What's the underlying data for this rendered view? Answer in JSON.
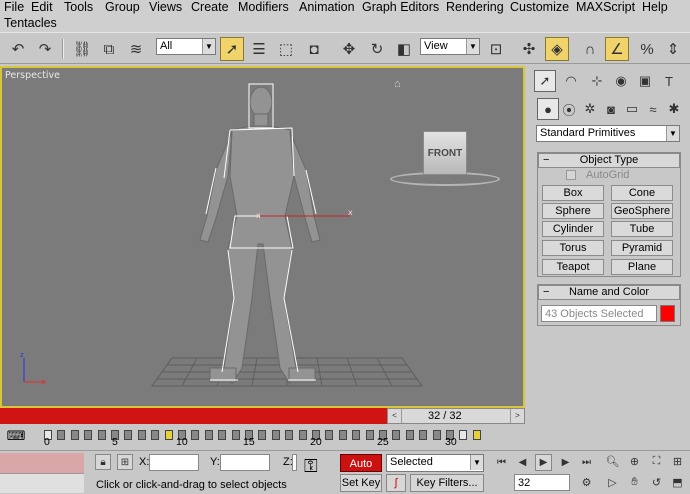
{
  "menu": {
    "items": [
      "File",
      "Edit",
      "Tools",
      "Group",
      "Views",
      "Create",
      "Modifiers",
      "Animation",
      "Graph Editors",
      "Rendering",
      "Customize",
      "MAXScript",
      "Help"
    ],
    "second_row": "Tentacles"
  },
  "toolbar": {
    "selection_filter": "All",
    "reference_coord": "View"
  },
  "viewport": {
    "label": "Perspective",
    "viewcube_face": "FRONT"
  },
  "timeline": {
    "frame_display": "32 / 32",
    "tick_labels": [
      "0",
      "5",
      "10",
      "15",
      "20",
      "25",
      "30"
    ]
  },
  "command_panel": {
    "category": "Standard Primitives",
    "object_type_title": "Object Type",
    "autogrid_label": "AutoGrid",
    "primitives": [
      "Box",
      "Cone",
      "Sphere",
      "GeoSphere",
      "Cylinder",
      "Tube",
      "Torus",
      "Pyramid",
      "Teapot",
      "Plane"
    ],
    "name_color_title": "Name and Color",
    "name_field": "43 Objects Selected",
    "object_color": "#ff0000"
  },
  "status": {
    "x_label": "X:",
    "y_label": "Y:",
    "z_label": "Z:",
    "prompt": "Click or click-and-drag to select objects",
    "auto_key": "Auto Key",
    "set_key": "Set Key",
    "key_mode": "Selected",
    "key_filters": "Key Filters...",
    "current_frame": "32"
  },
  "colors": {
    "viewport_bg": "#7b7b7b",
    "active_border": "#d8c63a",
    "timeline_red": "#d01414",
    "auto_key_red": "#cc1111"
  }
}
